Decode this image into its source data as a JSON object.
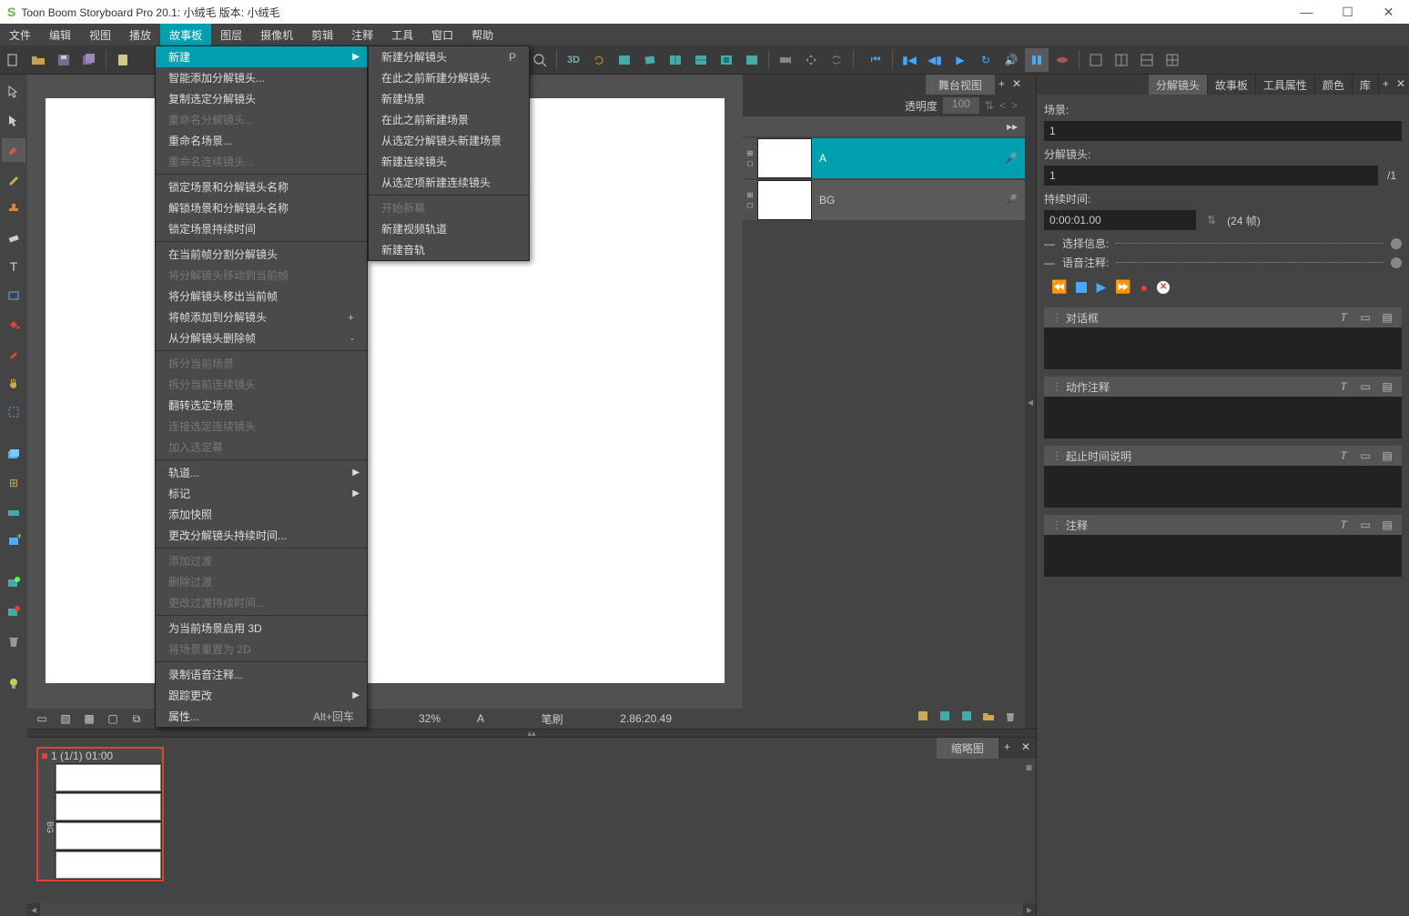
{
  "title": "Toon Boom Storyboard Pro 20.1:  小绒毛 版本: 小绒毛",
  "menubar": [
    "文件",
    "编辑",
    "视图",
    "播放",
    "故事板",
    "图层",
    "摄像机",
    "剪辑",
    "注释",
    "工具",
    "窗口",
    "帮助"
  ],
  "menubar_active_index": 4,
  "dropdown_main": [
    {
      "label": "新建",
      "arrow": true,
      "highlight": true
    },
    {
      "label": "智能添加分解镜头..."
    },
    {
      "label": "复制选定分解镜头"
    },
    {
      "label": "重命名分解镜头...",
      "disabled": true
    },
    {
      "label": "重命名场景..."
    },
    {
      "label": "重命名连续镜头...",
      "disabled": true
    },
    {
      "sep": true
    },
    {
      "label": "锁定场景和分解镜头名称"
    },
    {
      "label": "解锁场景和分解镜头名称"
    },
    {
      "label": "锁定场景持续时间"
    },
    {
      "sep": true
    },
    {
      "label": "在当前帧分割分解镜头"
    },
    {
      "label": "将分解镜头移动到当前帧",
      "disabled": true
    },
    {
      "label": "将分解镜头移出当前帧"
    },
    {
      "label": "将帧添加到分解镜头",
      "short": "+"
    },
    {
      "label": "从分解镜头删除帧",
      "short": "-"
    },
    {
      "sep": true
    },
    {
      "label": "拆分当前场景",
      "disabled": true
    },
    {
      "label": "拆分当前连续镜头",
      "disabled": true
    },
    {
      "label": "翻转选定场景"
    },
    {
      "label": "连接选定连续镜头",
      "disabled": true
    },
    {
      "label": "加入选定幕",
      "disabled": true
    },
    {
      "sep": true
    },
    {
      "label": "轨道...",
      "arrow": true
    },
    {
      "label": "标记",
      "arrow": true
    },
    {
      "label": "添加快照"
    },
    {
      "label": "更改分解镜头持续时间..."
    },
    {
      "sep": true
    },
    {
      "label": "添加过渡",
      "disabled": true
    },
    {
      "label": "删除过渡",
      "disabled": true
    },
    {
      "label": "更改过渡持续时间...",
      "disabled": true
    },
    {
      "sep": true
    },
    {
      "label": "为当前场景启用 3D"
    },
    {
      "label": "将场景重置为 2D",
      "disabled": true
    },
    {
      "sep": true
    },
    {
      "label": "录制语音注释..."
    },
    {
      "label": "跟踪更改",
      "arrow": true
    },
    {
      "label": "属性...",
      "short": "Alt+回车"
    }
  ],
  "dropdown_sub": [
    {
      "label": "新建分解镜头",
      "short": "P"
    },
    {
      "label": "在此之前新建分解镜头"
    },
    {
      "label": "新建场景"
    },
    {
      "label": "在此之前新建场景"
    },
    {
      "label": "从选定分解镜头新建场景"
    },
    {
      "label": "新建连续镜头"
    },
    {
      "label": "从选定项新建连续镜头"
    },
    {
      "sep": true
    },
    {
      "label": "开始新幕",
      "disabled": true
    },
    {
      "label": "新建视频轨道"
    },
    {
      "label": "新建音轨"
    }
  ],
  "layers": {
    "tab": "舞台视图",
    "transparency_label": "透明度",
    "transparency_value": "100",
    "rows": [
      {
        "name": "A",
        "selected": true
      },
      {
        "name": "BG",
        "selected": false
      }
    ]
  },
  "status": {
    "zoom": "32%",
    "frame": "A",
    "tool": "笔刷",
    "coord": "2.86:20.49"
  },
  "right": {
    "tabs": [
      "分解镜头",
      "故事板",
      "工具属性",
      "颜色",
      "库"
    ],
    "active_tab_index": 0,
    "scene_label": "场景:",
    "scene_value": "1",
    "panel_label": "分解镜头:",
    "panel_value": "1",
    "panel_frac": "/1",
    "duration_label": "持续时间:",
    "duration_value": "0:00:01.00",
    "duration_frames": "(24 帧)",
    "select_info": "选择信息:",
    "voice_ann": "语音注释:",
    "captions": [
      "对话框",
      "动作注释",
      "起止时间说明",
      "注释"
    ]
  },
  "timeline": {
    "tab": "缩略图",
    "frame_label": "1 (1/1) 01:00",
    "side_label": "BG"
  }
}
